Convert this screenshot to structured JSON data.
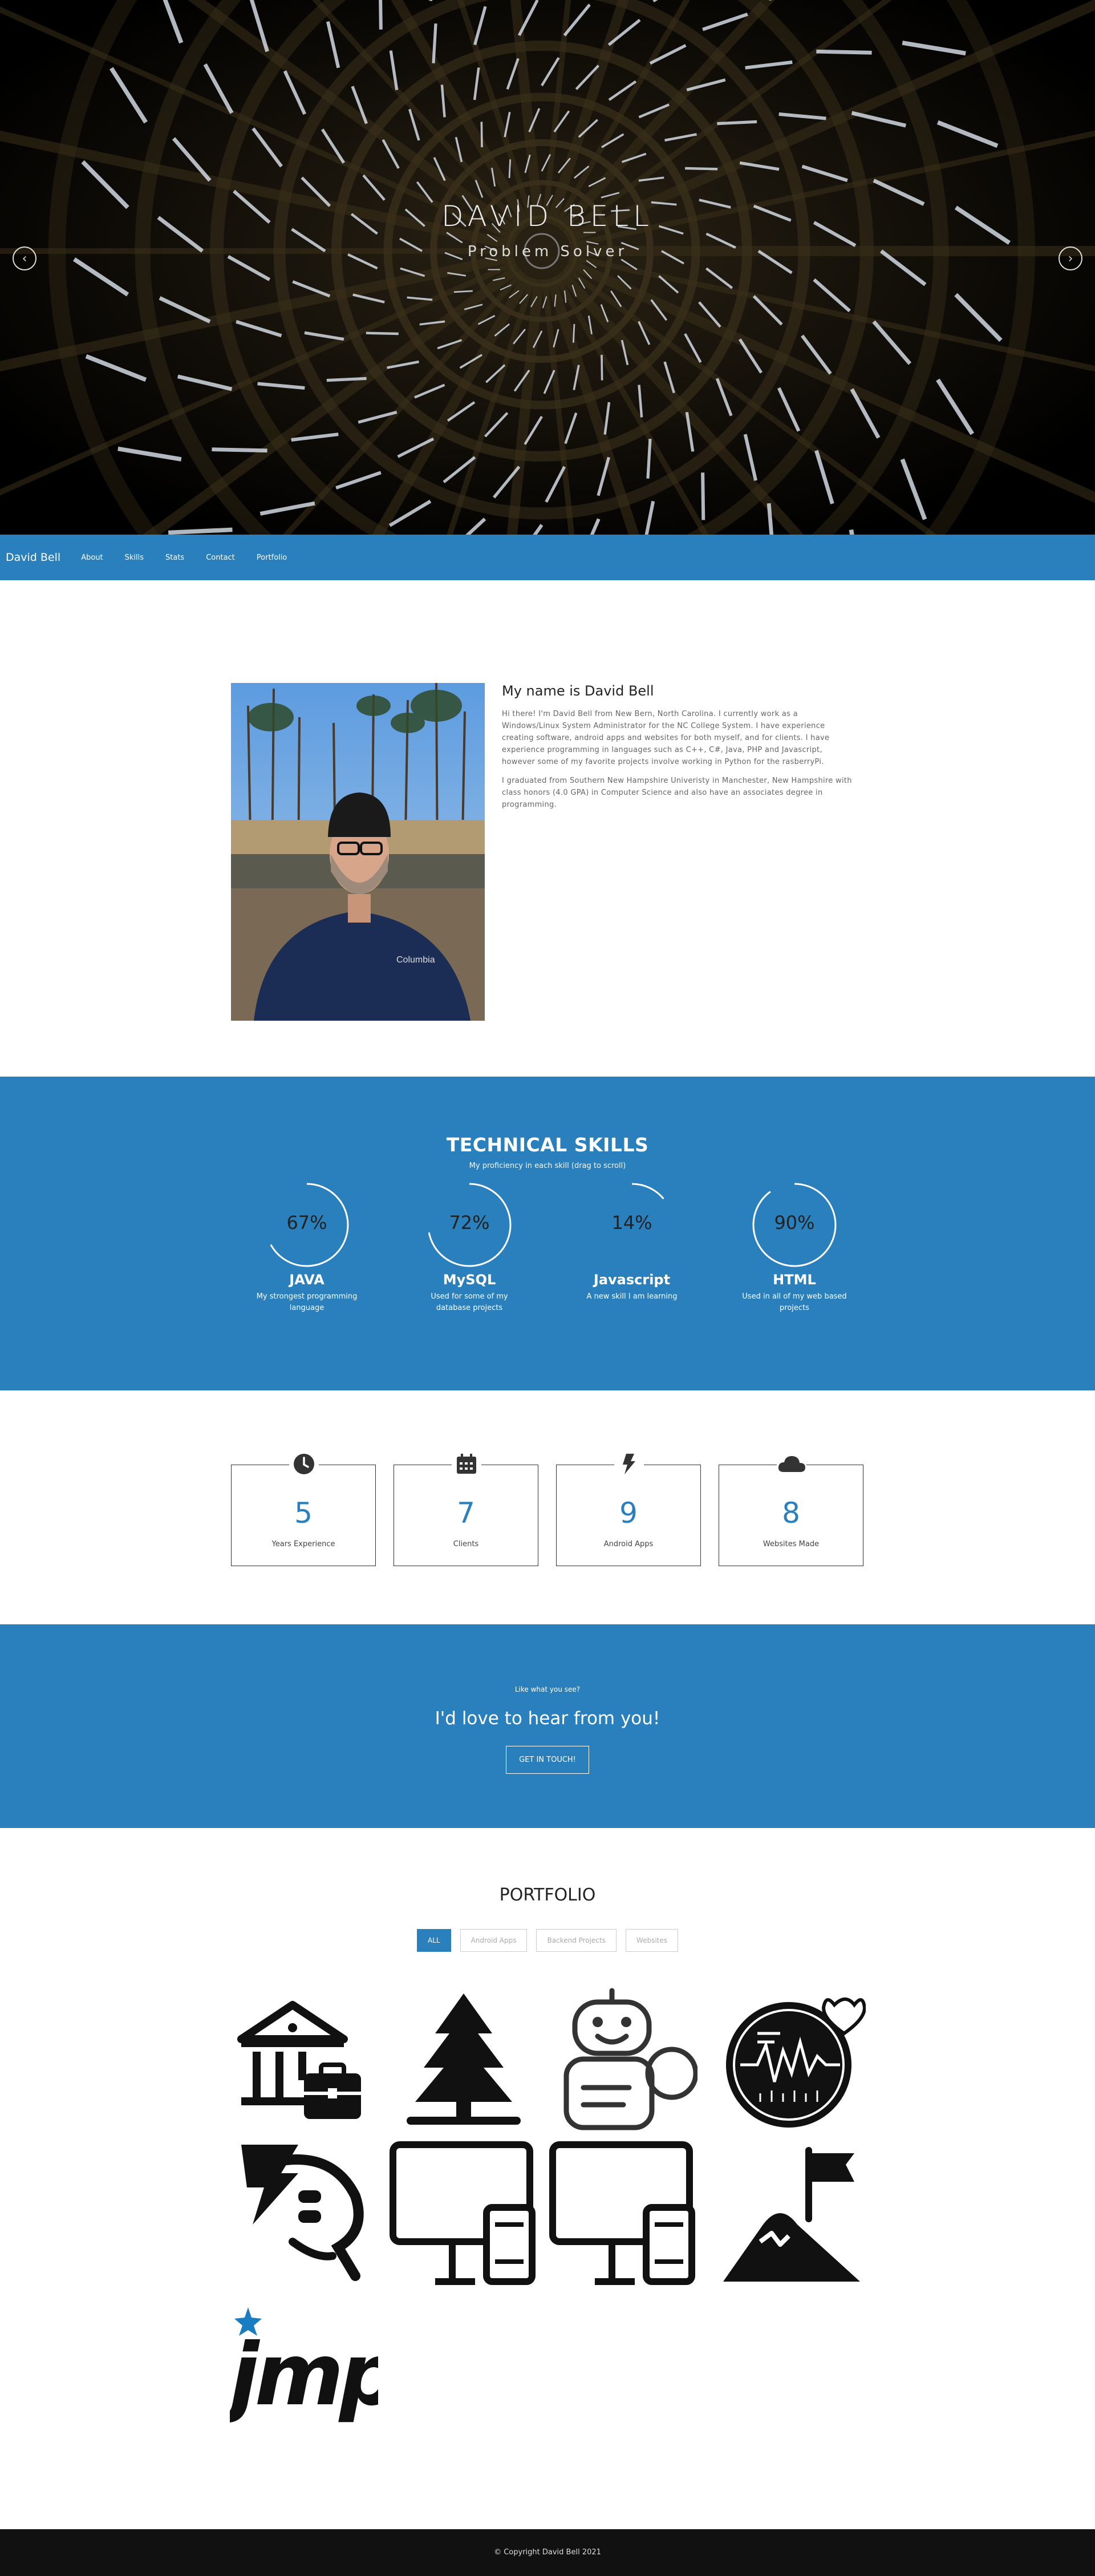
{
  "hero": {
    "name": "DAVID BELL",
    "subtitle": "Problem Solver",
    "prev_icon": "chevron-left-icon",
    "next_icon": "chevron-right-icon"
  },
  "nav": {
    "brand": "David Bell",
    "links": [
      "About",
      "Skills",
      "Stats",
      "Contact",
      "Portfolio"
    ]
  },
  "about": {
    "title": "My name is David Bell",
    "paragraphs": [
      "Hi there! I'm David Bell from New Bern, North Carolina. I currently work as a Windows/Linux System Administrator for the NC College System. I have experience creating software, android apps and websites for both myself, and for clients. I have experience programming in languages such as C++, C#, Java, PHP and Javascript, however some of my favorite projects involve working in Python for the rasberryPi.",
      "I graduated from Southern New Hampshire Univeristy in Manchester, New Hampshire with class honors (4.0 GPA) in Computer Science and also have an associates degree in programming."
    ]
  },
  "skills": {
    "title": "TECHNICAL SKILLS",
    "subtitle": "My proficiency in each skill (drag to scroll)",
    "items": [
      {
        "percent": 67,
        "label": "67%",
        "name": "JAVA",
        "desc": "My strongest programming language"
      },
      {
        "percent": 72,
        "label": "72%",
        "name": "MySQL",
        "desc": "Used for some of my database projects"
      },
      {
        "percent": 14,
        "label": "14%",
        "name": "Javascript",
        "desc": "A new skill I am learning"
      },
      {
        "percent": 90,
        "label": "90%",
        "name": "HTML",
        "desc": "Used in all of my web based projects"
      }
    ]
  },
  "stats": [
    {
      "icon": "clock-icon",
      "value": "5",
      "label": "Years Experience"
    },
    {
      "icon": "calendar-icon",
      "value": "7",
      "label": "Clients"
    },
    {
      "icon": "bolt-icon",
      "value": "9",
      "label": "Android Apps"
    },
    {
      "icon": "cloud-icon",
      "value": "8",
      "label": "Websites Made"
    }
  ],
  "cta": {
    "small": "Like what you see?",
    "big": "I'd love to hear from you!",
    "button": "GET IN TOUCH!"
  },
  "portfolio": {
    "title": "PORTFOLIO",
    "filters": [
      "ALL",
      "Android Apps",
      "Backend Projects",
      "Websites"
    ],
    "tiles": [
      "bank-briefcase-icon",
      "pine-tree-icon",
      "robot-icon",
      "heart-monitor-icon",
      "hand-holding-bolt-icon",
      "desktop-phone-icon",
      "desktop-phone-icon",
      "mountain-flag-icon",
      "jmp-logo"
    ]
  },
  "footer": {
    "text": "© Copyright David Bell 2021"
  },
  "colors": {
    "accent": "#2980bd",
    "footer": "#111111"
  }
}
